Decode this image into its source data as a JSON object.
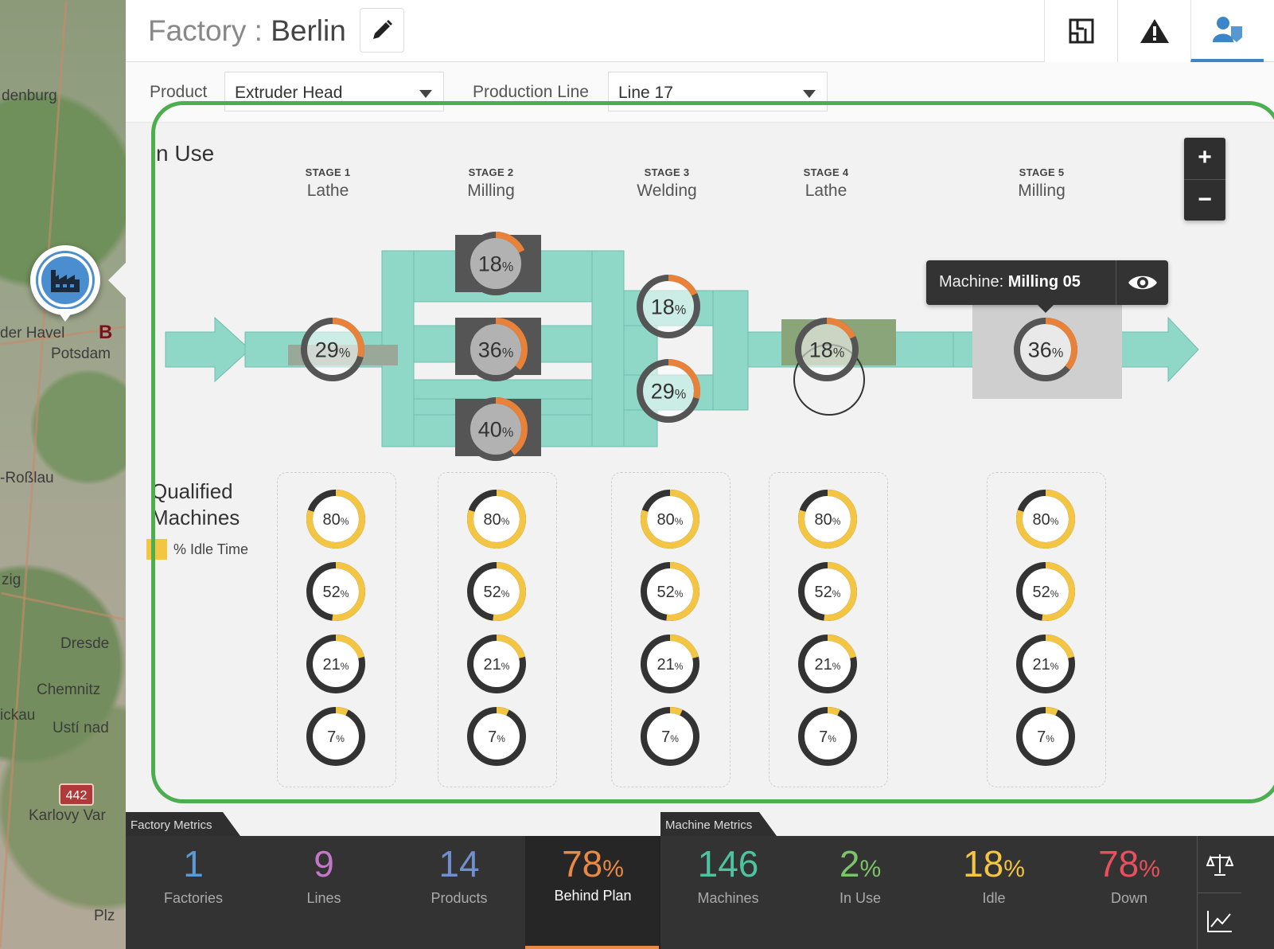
{
  "header": {
    "title_label": "Factory",
    "title_separator": ":",
    "factory_name": "Berlin"
  },
  "filters": {
    "product_label": "Product",
    "product_value": "Extruder Head",
    "line_label": "Production Line",
    "line_value": "Line 17"
  },
  "map": {
    "places": [
      "denburg",
      "der Havel",
      "B",
      "Potsdam",
      "-Roßlau",
      "zig",
      "Dresde",
      "Chemnitz",
      "ickau",
      "Ustí nad",
      "442",
      "Karlovy Var",
      "Plz"
    ]
  },
  "in_use": {
    "title": "n Use",
    "stages": [
      {
        "num": "STAGE 1",
        "name": "Lathe"
      },
      {
        "num": "STAGE 2",
        "name": "Milling"
      },
      {
        "num": "STAGE 3",
        "name": "Welding"
      },
      {
        "num": "STAGE 4",
        "name": "Lathe"
      },
      {
        "num": "STAGE 5",
        "name": "Milling"
      }
    ],
    "machines": [
      {
        "stage": 1,
        "value": 29
      },
      {
        "stage": 2,
        "value": 18
      },
      {
        "stage": 2,
        "value": 36
      },
      {
        "stage": 2,
        "value": 40
      },
      {
        "stage": 3,
        "value": 18
      },
      {
        "stage": 3,
        "value": 29
      },
      {
        "stage": 4,
        "value": 18
      },
      {
        "stage": 5,
        "value": 36
      }
    ],
    "pct_symbol": "%",
    "colors": {
      "flow": "#8fd8c8",
      "ring": "#e8823a",
      "ring_track": "#555555"
    }
  },
  "tooltip": {
    "label": "Machine:",
    "machine_name": "Milling 05"
  },
  "qualified": {
    "title_line1": "Qualified",
    "title_line2": "Machines",
    "legend": "% Idle Time",
    "values": [
      80,
      52,
      21,
      7
    ],
    "colors": {
      "ring": "#f4c542",
      "track": "#333333"
    }
  },
  "metrics": {
    "factory_tab": "Factory Metrics",
    "machine_tab": "Machine Metrics",
    "factory": [
      {
        "value": "1",
        "pct": "",
        "label": "Factories",
        "color": "#5b9bd5"
      },
      {
        "value": "9",
        "pct": "",
        "label": "Lines",
        "color": "#c477c9"
      },
      {
        "value": "14",
        "pct": "",
        "label": "Products",
        "color": "#6f8fd0"
      },
      {
        "value": "78",
        "pct": "%",
        "label": "Behind Plan",
        "color": "#e88a46"
      }
    ],
    "machine": [
      {
        "value": "146",
        "pct": "",
        "label": "Machines",
        "color": "#4ec3a0"
      },
      {
        "value": "2",
        "pct": "%",
        "label": "In Use",
        "color": "#7cc46a"
      },
      {
        "value": "18",
        "pct": "%",
        "label": "Idle",
        "color": "#f4c542"
      },
      {
        "value": "78",
        "pct": "%",
        "label": "Down",
        "color": "#e8505b"
      }
    ]
  },
  "icons": [
    "pencil-icon",
    "floorplan-icon",
    "alert-icon",
    "users-icon",
    "factory-icon",
    "eye-icon",
    "scale-icon",
    "chart-icon"
  ]
}
